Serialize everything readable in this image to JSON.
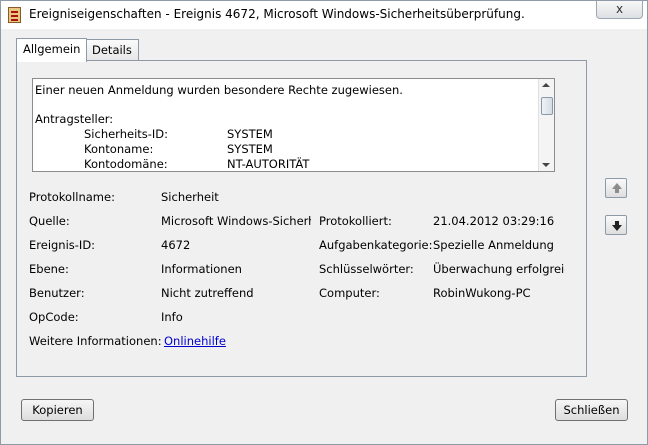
{
  "window": {
    "title": "Ereigniseigenschaften - Ereignis 4672, Microsoft Windows-Sicherheitsüberprüfung.",
    "close_label": "x"
  },
  "tabs": [
    {
      "label": "Allgemein",
      "active": true
    },
    {
      "label": "Details",
      "active": false
    }
  ],
  "description": {
    "line1": "Einer neuen Anmeldung wurden besondere Rechte zugewiesen.",
    "section": "Antragsteller:",
    "rows": [
      {
        "key": "Sicherheits-ID:",
        "value": "SYSTEM"
      },
      {
        "key": "Kontoname:",
        "value": "SYSTEM"
      },
      {
        "key": "Kontodomäne:",
        "value": "NT-AUTORITÄT"
      }
    ]
  },
  "fields": {
    "protokollname": {
      "label": "Protokollname:",
      "value": "Sicherheit"
    },
    "quelle": {
      "label": "Quelle:",
      "value": "Microsoft Windows-Sicherhе"
    },
    "protokolliert": {
      "label": "Protokolliert:",
      "value": "21.04.2012 03:29:16"
    },
    "ereignis_id": {
      "label": "Ereignis-ID:",
      "value": "4672"
    },
    "aufgabenkategorie": {
      "label": "Aufgabenkategorie:",
      "value": "Spezielle Anmeldung"
    },
    "ebene": {
      "label": "Ebene:",
      "value": "Informationen"
    },
    "schluesselwoerter": {
      "label": "Schlüsselwörter:",
      "value": "Überwachung erfolgreic"
    },
    "benutzer": {
      "label": "Benutzer:",
      "value": "Nicht zutreffend"
    },
    "computer": {
      "label": "Computer:",
      "value": "RobinWukong-PC"
    },
    "opcode": {
      "label": "OpCode:",
      "value": "Info"
    },
    "weitere": {
      "label": "Weitere Informationen:",
      "link": "Onlinehilfe"
    }
  },
  "buttons": {
    "copy": "Kopieren",
    "close": "Schließen"
  },
  "colors": {
    "link": "#0000cc",
    "border": "#8e9aa8",
    "background": "#f0f0f0"
  }
}
